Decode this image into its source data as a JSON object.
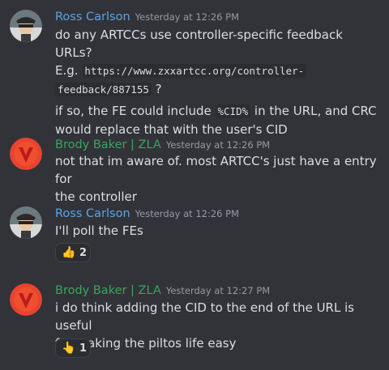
{
  "colors": {
    "ross": "#5aa4e6",
    "brody": "#3ba55d"
  },
  "messages": [
    {
      "author": "Ross Carlson",
      "timestamp": "Yesterday at 12:26 PM",
      "line1": "do any ARTCCs use controller-specific feedback URLs?",
      "eg_prefix": "E.g. ",
      "code_url_a": "https://www.zxxartcc.org/controller-",
      "code_url_b": "feedback/887155",
      "eg_suffix": " ?",
      "line3_a": "if so, the FE could include ",
      "line3_code": "%CID%",
      "line3_b": " in the URL, and CRC",
      "line4": "would replace that with the user's CID"
    },
    {
      "author": "Brody Baker | ZLA",
      "timestamp": "Yesterday at 12:26 PM",
      "line1": "not that im aware of. most ARTCC's just have a entry for",
      "line2": "the controller"
    },
    {
      "author": "Ross Carlson",
      "timestamp": "Yesterday at 12:26 PM",
      "line1": "I'll poll the FEs",
      "reaction": {
        "emoji": "👍",
        "count": "2"
      }
    },
    {
      "author": "Brody Baker | ZLA",
      "timestamp": "Yesterday at 12:27 PM",
      "line1": "i do think adding the CID to the end of the URL is useful",
      "line2": "for making the piltos life easy",
      "reaction": {
        "emoji": "👆",
        "count": "1"
      }
    }
  ]
}
